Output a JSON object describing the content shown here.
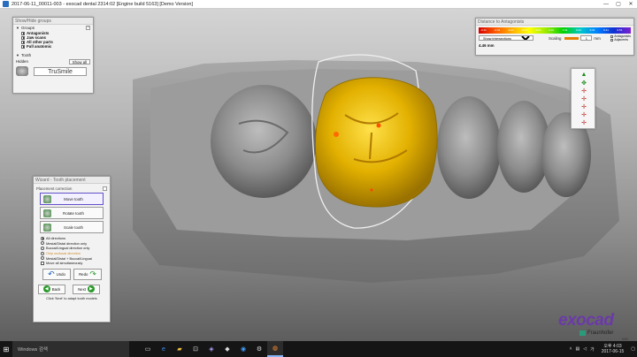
{
  "window": {
    "title": "2017-06-11_00011-003 - exocad dental 2314:02 [Engine build 5163] [Demo Version]",
    "minimize": "—",
    "maximize": "▢",
    "close": "✕"
  },
  "groups_panel": {
    "title": "Show/Hide groups",
    "groups_header": "Groups",
    "help": "?",
    "items": [
      {
        "label": "Antagonists",
        "checked": true
      },
      {
        "label": "Jaw scans",
        "checked": true
      },
      {
        "label": "All other parts",
        "checked": true
      },
      {
        "label": "Full anatomic",
        "checked": true
      }
    ],
    "tooth_header": "Tooth",
    "hidden_label": "Hidden",
    "show_all": "Show all",
    "trusmile": "TruSmile"
  },
  "antagonist_panel": {
    "title": "Distance to Antagonists",
    "scale_labels": [
      "-0.41",
      "-0.31",
      "-0.21",
      "-0.11",
      "-0.01",
      "0.01",
      "0.11",
      "0.21",
      "0.31",
      "0.41",
      "0.51"
    ],
    "mode": "Show intersections",
    "scaling_label": "Scaling",
    "scaling_value": "1",
    "unit": "mm",
    "antagonists": "Antagonists",
    "adjacents": "Adjacents",
    "distance": "4.46 mm"
  },
  "wizard": {
    "title": "Wizard - Tooth placement",
    "subtitle": "Placement correction",
    "help": "?",
    "buttons": [
      "Move tooth",
      "Rotate tooth",
      "Scale tooth"
    ],
    "radios": [
      {
        "label": "All directions",
        "checked": true
      },
      {
        "label": "Mesial/Distal direction only",
        "checked": false
      },
      {
        "label": "Buccal/Lingual direction only",
        "checked": false
      },
      {
        "label": "Only occlusal direction",
        "checked": false,
        "disabled": true
      },
      {
        "label": "Mesial/Distal + Buccal/Lingual",
        "checked": false
      }
    ],
    "move_all": "Move all simultaneously",
    "undo": "Undo",
    "redo": "Redo",
    "back": "Back",
    "next": "Next",
    "hint": "Click 'Next' to adapt tooth models"
  },
  "logo": {
    "word": "exocad",
    "fraunhofer": "Fraunhofer",
    "dd": "IGD"
  },
  "taskbar": {
    "search_placeholder": "Windows 검색",
    "time": "오후 4:03",
    "date": "2017-06-15"
  },
  "colors": {
    "crown": "#e8b800",
    "jaw": "#8f8f8f",
    "accent": "#6b3aa8"
  }
}
